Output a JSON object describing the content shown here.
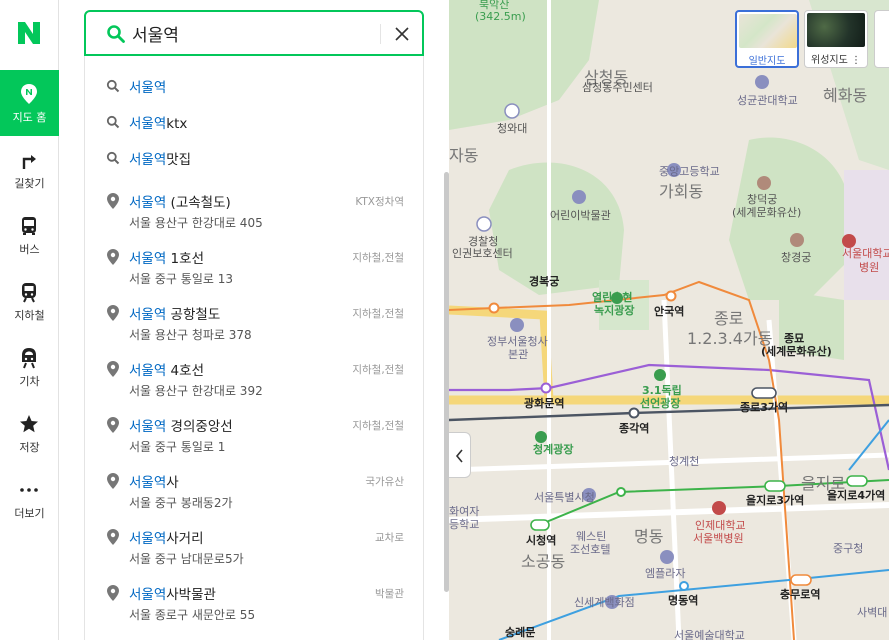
{
  "nav": {
    "logo": "N",
    "items": [
      {
        "label": "지도 홈",
        "icon": "map-home-icon",
        "active": true
      },
      {
        "label": "길찾기",
        "icon": "directions-icon"
      },
      {
        "label": "버스",
        "icon": "bus-icon"
      },
      {
        "label": "지하철",
        "icon": "subway-icon"
      },
      {
        "label": "기차",
        "icon": "train-icon"
      },
      {
        "label": "저장",
        "icon": "star-icon"
      },
      {
        "label": "더보기",
        "icon": "more-icon"
      }
    ]
  },
  "search": {
    "query": "서울역"
  },
  "suggestions": {
    "keywords": [
      {
        "match": "서울역",
        "rest": ""
      },
      {
        "match": "서울역",
        "rest": "ktx"
      },
      {
        "match": "서울역",
        "rest": "맛집"
      }
    ],
    "places": [
      {
        "match": "서울역",
        "rest": " (고속철도)",
        "address": "서울 용산구 한강대로 405",
        "category": "KTX정차역"
      },
      {
        "match": "서울역",
        "rest": " 1호선",
        "address": "서울 중구 통일로 13",
        "category": "지하철,전철"
      },
      {
        "match": "서울역",
        "rest": " 공항철도",
        "address": "서울 용산구 청파로 378",
        "category": "지하철,전철"
      },
      {
        "match": "서울역",
        "rest": " 4호선",
        "address": "서울 용산구 한강대로 392",
        "category": "지하철,전철"
      },
      {
        "match": "서울역",
        "rest": " 경의중앙선",
        "address": "서울 중구 통일로 1",
        "category": "지하철,전철"
      },
      {
        "match": "서울역",
        "rest": "사",
        "address": "서울 중구 봉래동2가",
        "category": "국가유산"
      },
      {
        "match": "서울역",
        "rest": "사거리",
        "address": "서울 중구 남대문로5가",
        "category": "교차로"
      },
      {
        "match": "서울역",
        "rest": "사박물관",
        "address": "서울 종로구 새문안로 55",
        "category": "박물관"
      }
    ]
  },
  "map": {
    "type_buttons": [
      {
        "label": "일반지도",
        "selected": true
      },
      {
        "label": "위성지도 ⋮",
        "selected": false
      }
    ],
    "labels": {
      "mountain": "북악산",
      "mountain_height": "(342.5m)",
      "samcheong_dong": "삼청동",
      "samcheong_office": "삼청동주민센터",
      "sungkyunkwan": "성균관대학교",
      "hyehwa": "혜화동",
      "cheongwadae": "청와대",
      "jadong": "자동",
      "jungang_high": "중앙고등학교",
      "gahoe": "가회동",
      "childrens_museum": "어린이박물관",
      "changdeokgung": "창덕궁",
      "changdeokgung_sub": "(세계문화유산)",
      "police": "경찰청",
      "police_sub": "인권보호센터",
      "gyeongbokgung": "경복궁",
      "changgyeonggung": "창경궁",
      "snu_hospital": "서울대학교",
      "snu_hospital_sub": "병원",
      "yeolin": "열린송현",
      "yeolin_sub": "녹지광장",
      "anguk": "안국역",
      "jongno_big": "종로",
      "jongno_sub": "1.2.3.4가동",
      "jongmyo": "종묘",
      "jongmyo_sub": "(세계문화유산)",
      "gov_complex": "정부서울청사",
      "gov_complex_sub": "본관",
      "gwanghwamun": "광화문역",
      "independence": "3.1독립",
      "independence_sub": "선언광장",
      "jongno3": "종로3가역",
      "jonggak": "종각역",
      "cheonggye_plaza": "청계광장",
      "cheonggyecheon": "청계천",
      "euljiro_big": "을지로",
      "euljiro3": "을지로3가역",
      "euljiro4": "을지로4가역",
      "seoul_hall": "서울특별시청",
      "girls_school": "화여자",
      "girls_school_sub": "등학교",
      "inje": "인제대학교",
      "inje_sub": "서울백병원",
      "cityhall": "시청역",
      "sogong": "소공동",
      "westin": "웨스틴",
      "westin_sub": "조선호텔",
      "myeongdong_big": "명동",
      "jung_office": "중구청",
      "embassy": "엠플라자",
      "myeongdong_station": "명동역",
      "chungmuro": "충무로역",
      "shinsegae": "신세계백화점",
      "sungnyemun": "숭례문",
      "art_school": "서울예술대학교",
      "saebyeok": "사벽대"
    }
  },
  "colors": {
    "accent": "#03c75a",
    "highlight": "#0068c3"
  }
}
